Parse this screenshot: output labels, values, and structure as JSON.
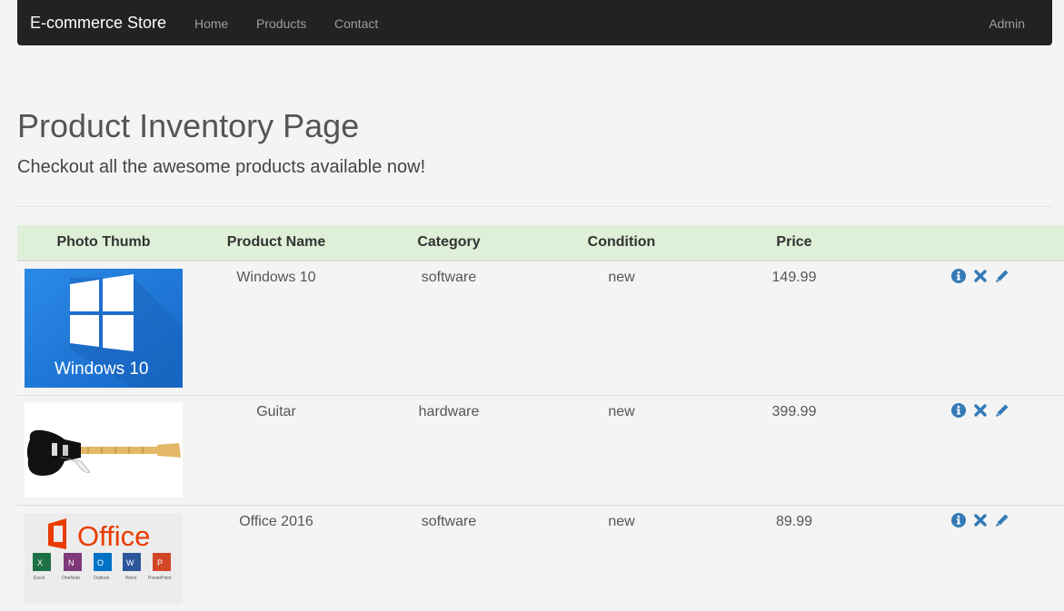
{
  "navbar": {
    "brand": "E-commerce Store",
    "links": [
      {
        "label": "Home"
      },
      {
        "label": "Products"
      },
      {
        "label": "Contact"
      }
    ],
    "admin_label": "Admin"
  },
  "header": {
    "title": "Product Inventory Page",
    "subtitle": "Checkout all the awesome products available now!"
  },
  "table": {
    "headers": [
      "Photo Thumb",
      "Product Name",
      "Category",
      "Condition",
      "Price"
    ],
    "rows": [
      {
        "name": "Windows 10",
        "category": "software",
        "condition": "new",
        "price": "149.99",
        "thumb_text": "Windows 10"
      },
      {
        "name": "Guitar",
        "category": "hardware",
        "condition": "new",
        "price": "399.99"
      },
      {
        "name": "Office 2016",
        "category": "software",
        "condition": "new",
        "price": "89.99",
        "thumb_text": "Office",
        "thumb_apps": [
          "Excel",
          "OneNote",
          "Outlook",
          "Word",
          "PowerPoint"
        ]
      }
    ]
  },
  "colors": {
    "navbar_bg": "#222222",
    "header_row_bg": "#dff0d8",
    "icon_blue": "#337ab7",
    "windows_blue": "#1a78d6",
    "office_orange": "#eb3c00"
  },
  "icons": {
    "info": "info-icon",
    "delete": "remove-icon",
    "edit": "pencil-icon"
  }
}
